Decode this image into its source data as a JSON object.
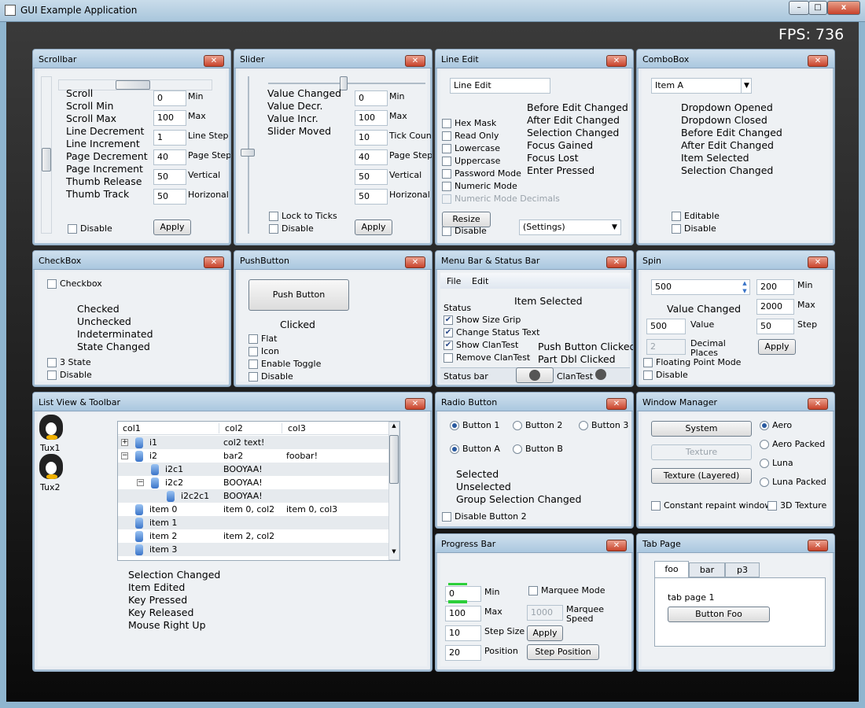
{
  "window": {
    "title": "GUI Example Application",
    "min": "–",
    "max": "□",
    "close": "x"
  },
  "fps": "FPS: 736",
  "panels": {
    "scrollbar": {
      "title": "Scrollbar",
      "events": [
        "Scroll",
        "Scroll Min",
        "Scroll Max",
        "Line Decrement",
        "Line Increment",
        "Page Decrement",
        "Page Increment",
        "Thumb Release",
        "Thumb Track"
      ],
      "fields": [
        {
          "value": "0",
          "label": "Min"
        },
        {
          "value": "100",
          "label": "Max"
        },
        {
          "value": "1",
          "label": "Line Step"
        },
        {
          "value": "40",
          "label": "Page Step"
        },
        {
          "value": "50",
          "label": "Vertical"
        },
        {
          "value": "50",
          "label": "Horizonal"
        }
      ],
      "disable": "Disable",
      "apply": "Apply"
    },
    "slider": {
      "title": "Slider",
      "events": [
        "Value Changed",
        "Value Decr.",
        "Value Incr.",
        "Slider Moved"
      ],
      "fields": [
        {
          "value": "0",
          "label": "Min"
        },
        {
          "value": "100",
          "label": "Max"
        },
        {
          "value": "10",
          "label": "Tick Count"
        },
        {
          "value": "40",
          "label": "Page Step"
        },
        {
          "value": "50",
          "label": "Vertical"
        },
        {
          "value": "50",
          "label": "Horizonal"
        }
      ],
      "lock": "Lock to Ticks",
      "disable": "Disable",
      "apply": "Apply"
    },
    "lineedit": {
      "title": "Line Edit",
      "value": "Line Edit",
      "checks": [
        "Hex Mask",
        "Read Only",
        "Lowercase",
        "Uppercase",
        "Password Mode",
        "Numeric Mode",
        "Numeric Mode Decimals"
      ],
      "events": [
        "Before Edit Changed",
        "After Edit Changed",
        "Selection Changed",
        "Focus Gained",
        "Focus Lost",
        "Enter Pressed"
      ],
      "resize": "Resize",
      "disable": "Disable",
      "settings": "(Settings)"
    },
    "combobox": {
      "title": "ComboBox",
      "value": "Item A",
      "events": [
        "Dropdown Opened",
        "Dropdown Closed",
        "Before Edit Changed",
        "After Edit Changed",
        "Item Selected",
        "Selection Changed"
      ],
      "editable": "Editable",
      "disable": "Disable"
    },
    "checkbox": {
      "title": "CheckBox",
      "label": "Checkbox",
      "events": [
        "Checked",
        "Unchecked",
        "Indeterminated",
        "State Changed"
      ],
      "threestate": "3 State",
      "disable": "Disable"
    },
    "pushbutton": {
      "title": "PushButton",
      "button": "Push Button",
      "event": "Clicked",
      "checks": [
        "Flat",
        "Icon",
        "Enable Toggle",
        "Disable"
      ]
    },
    "menubar": {
      "title": "Menu Bar & Status Bar",
      "menus": [
        "File",
        "Edit"
      ],
      "status": "Status",
      "item_selected": "Item Selected",
      "checks": [
        "Show Size Grip",
        "Change Status Text",
        "Show ClanTest",
        "Remove ClanTest"
      ],
      "events": [
        "Push Button Clicked",
        "Part Dbl Clicked"
      ],
      "statusbar": "Status bar",
      "clantest": "ClanTest"
    },
    "spin": {
      "title": "Spin",
      "spin_value": "500",
      "value_changed": "Value Changed",
      "fields": [
        {
          "value": "200",
          "label": "Min"
        },
        {
          "value": "2000",
          "label": "Max"
        },
        {
          "value": "50",
          "label": "Step"
        }
      ],
      "value_field": "500",
      "value_label": "Value",
      "decimal_field": "2",
      "decimal_label": "Decimal Places",
      "apply": "Apply",
      "floating": "Floating Point Mode",
      "disable": "Disable"
    },
    "listview": {
      "title": "List View & Toolbar",
      "tux1": "Tux1",
      "tux2": "Tux2",
      "columns": [
        "col1",
        "col2",
        "col3"
      ],
      "rows": [
        {
          "c1": "i1",
          "c2": "col2 text!",
          "c3": "",
          "indent": 0,
          "exp": "+"
        },
        {
          "c1": "i2",
          "c2": "bar2",
          "c3": "foobar!",
          "indent": 0,
          "exp": "−"
        },
        {
          "c1": "i2c1",
          "c2": "BOOYAA!",
          "c3": "",
          "indent": 1,
          "exp": ""
        },
        {
          "c1": "i2c2",
          "c2": "BOOYAA!",
          "c3": "",
          "indent": 1,
          "exp": "−"
        },
        {
          "c1": "i2c2c1",
          "c2": "BOOYAA!",
          "c3": "",
          "indent": 2,
          "exp": ""
        },
        {
          "c1": "item 0",
          "c2": "item 0, col2",
          "c3": "item 0, col3",
          "indent": 0,
          "exp": ""
        },
        {
          "c1": "item 1",
          "c2": "",
          "c3": "",
          "indent": 0,
          "exp": ""
        },
        {
          "c1": "item 2",
          "c2": "item 2, col2",
          "c3": "",
          "indent": 0,
          "exp": ""
        },
        {
          "c1": "item 3",
          "c2": "",
          "c3": "",
          "indent": 0,
          "exp": ""
        }
      ],
      "events": [
        "Selection Changed",
        "Item Edited",
        "Key Pressed",
        "Key Released",
        "Mouse Right Up"
      ]
    },
    "radio": {
      "title": "Radio Button",
      "buttons": [
        "Button 1",
        "Button 2",
        "Button 3",
        "Button A",
        "Button B"
      ],
      "events": [
        "Selected",
        "Unselected",
        "Group Selection Changed"
      ],
      "disable2": "Disable Button 2"
    },
    "progress": {
      "title": "Progress Bar",
      "progress_fraction": 0.5,
      "fields": [
        {
          "value": "0",
          "label": "Min"
        },
        {
          "value": "100",
          "label": "Max"
        },
        {
          "value": "10",
          "label": "Step Size"
        },
        {
          "value": "20",
          "label": "Position"
        }
      ],
      "marquee": "Marquee Mode",
      "marquee_speed_value": "1000",
      "marquee_speed_label": "Marquee Speed",
      "apply": "Apply",
      "step": "Step Position"
    },
    "windowmanager": {
      "title": "Window Manager",
      "buttons": [
        "System",
        "Texture",
        "Texture (Layered)"
      ],
      "radios": [
        "Aero",
        "Aero Packed",
        "Luna",
        "Luna Packed"
      ],
      "constant": "Constant repaint windows",
      "texture3d": "3D Texture"
    },
    "tabpage": {
      "title": "Tab Page",
      "tabs": [
        "foo",
        "bar",
        "p3"
      ],
      "label": "tab page 1",
      "button": "Button Foo"
    }
  }
}
